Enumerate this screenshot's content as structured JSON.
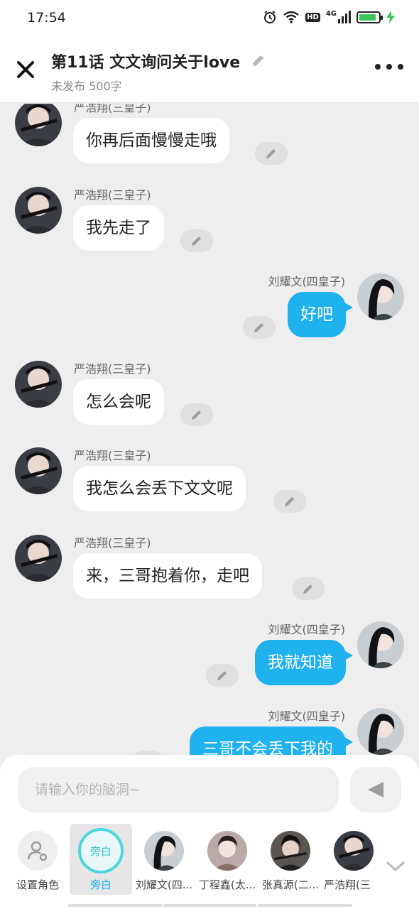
{
  "status_bar": {
    "time": "17:54",
    "icons": [
      "alarm-icon",
      "wifi-icon",
      "hd-icon",
      "signal-4g-icon",
      "battery-icon",
      "charging-icon"
    ],
    "hd_label": "HD",
    "network_label": "4G",
    "battery_level": 0.9
  },
  "header": {
    "title": "第11话  文文询问关于love",
    "subtitle": "未发布 500字",
    "icons": [
      "close-icon",
      "pencil-icon",
      "more-icon"
    ]
  },
  "messages": [
    {
      "side": "left",
      "name": "严浩翔(三皇子)",
      "text": "你再后面慢慢走哦"
    },
    {
      "side": "left",
      "name": "严浩翔(三皇子)",
      "text": "我先走了"
    },
    {
      "side": "right",
      "name": "刘耀文(四皇子)",
      "text": "好吧"
    },
    {
      "side": "left",
      "name": "严浩翔(三皇子)",
      "text": "怎么会呢"
    },
    {
      "side": "left",
      "name": "严浩翔(三皇子)",
      "text": "我怎么会丢下文文呢"
    },
    {
      "side": "left",
      "name": "严浩翔(三皇子)",
      "text": "来，三哥抱着你，走吧"
    },
    {
      "side": "right",
      "name": "刘耀文(四皇子)",
      "text": "我就知道"
    },
    {
      "side": "right",
      "name": "刘耀文(四皇子)",
      "text": "三哥不会丢下我的"
    }
  ],
  "composer": {
    "placeholder": "请输入你的脑洞~",
    "send_icon": "send-icon"
  },
  "characters": [
    {
      "label": "设置角色",
      "icon": "person-settings-icon"
    },
    {
      "label": "旁白",
      "ring_text": "旁白",
      "selected": true
    },
    {
      "label": "刘耀文(四..."
    },
    {
      "label": "丁程鑫(太..."
    },
    {
      "label": "张真源(二..."
    },
    {
      "label": "严浩翔(三"
    }
  ],
  "colors": {
    "accent_blue": "#1fb2ee",
    "narrator_teal": "#4dd6e0",
    "background": "#eeeeee",
    "battery_green": "#3cc35c"
  }
}
